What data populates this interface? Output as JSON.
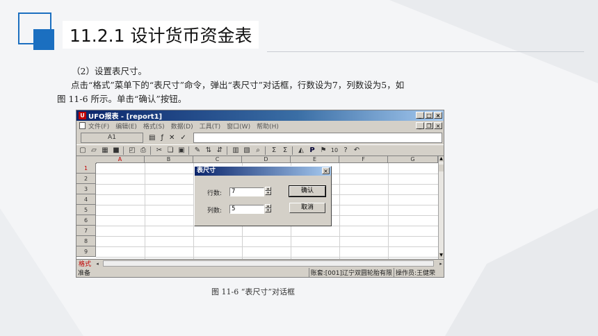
{
  "slide": {
    "title": "11.2.1  设计货币资金表",
    "step": "（2）设置表尺寸。",
    "paragraph_line1": "点击“格式”菜单下的“表尺寸”命令，弹出“表尺寸”对话框，行数设为7，列数设为5，如",
    "paragraph_line2": "图 11-6 所示。单击“确认”按钮。",
    "caption": "图 11-6  “表尺寸”对话框",
    "accent_color": "#1b6fc0"
  },
  "window": {
    "title": "UFO报表 - [report1]",
    "menu": [
      "文件(F)",
      "编辑(E)",
      "格式(S)",
      "数据(D)",
      "工具(T)",
      "窗口(W)",
      "帮助(H)"
    ],
    "cell_ref": "A1",
    "columns": [
      "A",
      "B",
      "C",
      "D",
      "E",
      "F",
      "G"
    ],
    "rows": [
      "1",
      "2",
      "3",
      "4",
      "5",
      "6",
      "7",
      "8",
      "9"
    ],
    "sheet_tab": "格式",
    "status_ready": "准备",
    "status_account": "账套:[001]辽宁双圆轮胎有限",
    "status_operator": "操作员:王健荣"
  },
  "dialog": {
    "title": "表尺寸",
    "rows_label": "行数:",
    "rows_value": "7",
    "cols_label": "列数:",
    "cols_value": "5",
    "confirm_label": "确认",
    "cancel_label": "取消"
  }
}
